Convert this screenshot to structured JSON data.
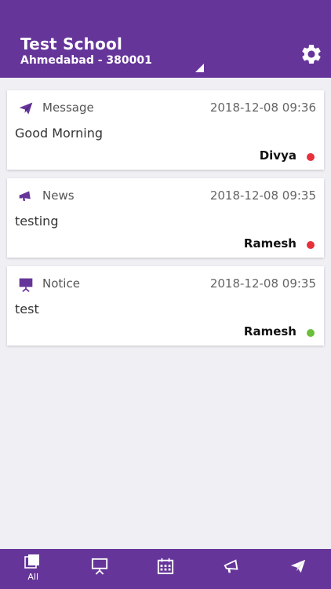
{
  "header": {
    "school_name": "Test School",
    "address": "Ahmedabad - 380001",
    "settings_icon": "gear-icon",
    "background_color": "#66359a"
  },
  "feed": [
    {
      "type": "Message",
      "icon": "paper-plane-icon",
      "timestamp": "2018-12-08 09:36",
      "body": "Good Morning",
      "author": "Divya",
      "status_color": "#e8303a"
    },
    {
      "type": "News",
      "icon": "megaphone-icon",
      "timestamp": "2018-12-08 09:35",
      "body": "testing",
      "author": "Ramesh",
      "status_color": "#e8303a"
    },
    {
      "type": "Notice",
      "icon": "presentation-board-icon",
      "timestamp": "2018-12-08 09:35",
      "body": "test",
      "author": "Ramesh",
      "status_color": "#6cbf3c"
    }
  ],
  "tabbar": {
    "tabs": [
      {
        "label": "All",
        "icon": "stacked-squares-icon",
        "selected": true
      },
      {
        "label": "",
        "icon": "presentation-board-icon",
        "selected": false
      },
      {
        "label": "",
        "icon": "calendar-icon",
        "selected": false
      },
      {
        "label": "",
        "icon": "megaphone-icon",
        "selected": false
      },
      {
        "label": "",
        "icon": "paper-plane-icon",
        "selected": false
      }
    ]
  },
  "accent_color": "#66359a"
}
